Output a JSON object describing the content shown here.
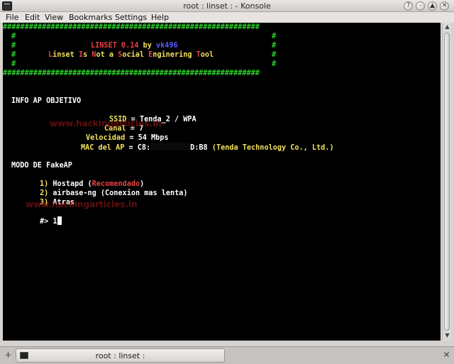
{
  "window": {
    "title": "root : linset : - Konsole",
    "btn_help": "?",
    "btn_minimize": "–",
    "btn_maximize": "▲",
    "btn_close": "✕"
  },
  "menu": [
    "File",
    "Edit",
    "View",
    "Bookmarks",
    "Settings",
    "Help"
  ],
  "banner": {
    "border": "###########################################################",
    "hash_left": "#",
    "hash_right": "#",
    "name": "LINSET 0.14",
    "by": " by ",
    "author": "vk496",
    "tag_parts": [
      "L",
      "inset ",
      "I",
      "s ",
      "N",
      "ot a ",
      "S",
      "ocial ",
      "E",
      "nginering ",
      "T",
      "ool"
    ]
  },
  "info": {
    "heading": "INFO AP OBJETIVO",
    "ssid_label": "SSID",
    "ssid_value": "Tenda_2 / WPA",
    "canal_label": "Canal",
    "canal_value": "7",
    "velocidad_label": "Velocidad",
    "velocidad_value": "54 Mbps",
    "mac_label": "MAC del AP",
    "mac_prefix": "C8:",
    "mac_suffix": "D:B8",
    "vendor": "(Tenda Technology Co., Ltd.)",
    "sep": " = "
  },
  "mode": {
    "heading": "MODO DE FakeAP",
    "options": [
      {
        "num": "1)",
        "text": "Hostapd (",
        "highlight": "Recomendado",
        "end": ")"
      },
      {
        "num": "2)",
        "text": "airbase-ng (Conexion mas lenta)",
        "highlight": "",
        "end": ""
      },
      {
        "num": "3)",
        "text": "Atras",
        "highlight": "",
        "end": ""
      }
    ]
  },
  "prompt": {
    "symbol": "#>",
    "input": "1"
  },
  "watermarks": [
    "www.hackingarticles.in",
    "www.hackingarticles.in"
  ],
  "taskbar": {
    "tab_label": "root : linset :",
    "new_tab_icon": "+",
    "close_tab_icon": "✕"
  },
  "scrollbar": {
    "up": "▲",
    "down": "▼"
  },
  "colors": {
    "terminal_bg": "#000000",
    "banner_green": "#2bd12b",
    "red": "#e84242",
    "yellow": "#f2e15e",
    "blue": "#5b5bff"
  }
}
